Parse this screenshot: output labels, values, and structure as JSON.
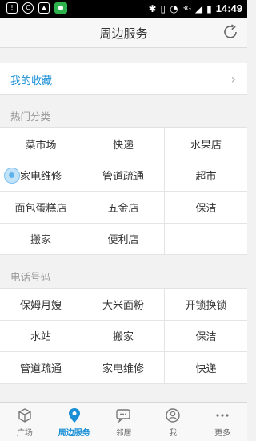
{
  "status_bar": {
    "time": "14:49",
    "network": "3G",
    "left_icons": [
      "notification-icon",
      "vpn-icon",
      "image-icon",
      "wechat-icon"
    ],
    "right_icons": [
      "bluetooth-icon",
      "vibrate-icon",
      "wifi-icon",
      "signal-icon",
      "battery-icon"
    ]
  },
  "header": {
    "title": "周边服务"
  },
  "favorites": {
    "label": "我的收藏"
  },
  "hot_categories": {
    "title": "热门分类",
    "items": [
      "菜市场",
      "快递",
      "水果店",
      "家电维修",
      "管道疏通",
      "超市",
      "面包蛋糕店",
      "五金店",
      "保洁",
      "搬家",
      "便利店",
      ""
    ]
  },
  "phone_numbers": {
    "title": "电话号码",
    "items": [
      "保姆月嫂",
      "大米面粉",
      "开锁换锁",
      "水站",
      "搬家",
      "保洁",
      "管道疏通",
      "家电维修",
      "快递"
    ]
  },
  "bottom_nav": {
    "active": "周边服务",
    "active_color": "#1a8fd6",
    "items": [
      {
        "label": "广场",
        "icon": "box-icon"
      },
      {
        "label": "周边服务",
        "icon": "location-pin-icon"
      },
      {
        "label": "邻居",
        "icon": "chat-icon"
      },
      {
        "label": "我",
        "icon": "person-icon"
      },
      {
        "label": "更多",
        "icon": "more-icon"
      }
    ]
  }
}
